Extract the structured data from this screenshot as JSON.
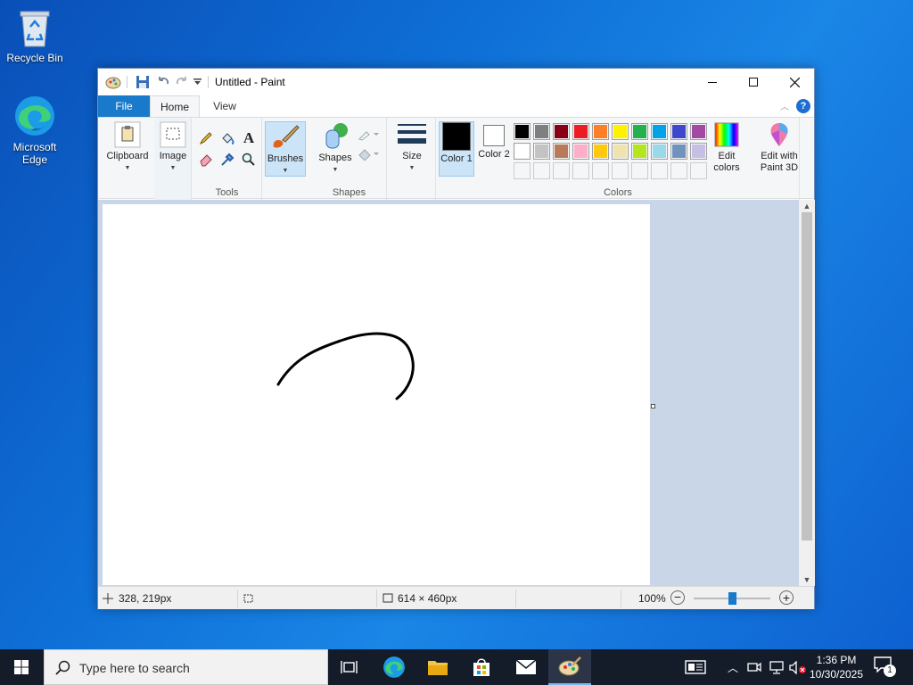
{
  "desktop": {
    "icons": [
      {
        "label": "Recycle Bin"
      },
      {
        "label": "Microsoft Edge"
      }
    ]
  },
  "window": {
    "title": "Untitled - Paint",
    "tabs": [
      "File",
      "Home",
      "View"
    ]
  },
  "ribbon": {
    "clipboard": "Clipboard",
    "image": "Image",
    "tools_label": "Tools",
    "brushes": "Brushes",
    "shapes": "Shapes",
    "shapes_label": "Shapes",
    "size": "Size",
    "color1": "Color 1",
    "color2": "Color 2",
    "colors_label": "Colors",
    "edit_colors": "Edit colors",
    "edit_paint3d": "Edit with Paint 3D",
    "color1_value": "#000000",
    "color2_value": "#ffffff",
    "palette_row1": [
      "#000000",
      "#7f7f7f",
      "#880015",
      "#ed1c24",
      "#ff7f27",
      "#fff200",
      "#22b14c",
      "#00a2e8",
      "#3f48cc",
      "#a349a4"
    ],
    "palette_row2": [
      "#ffffff",
      "#c3c3c3",
      "#b97a57",
      "#ffaec9",
      "#ffc90e",
      "#efe4b0",
      "#b5e61d",
      "#99d9ea",
      "#7092be",
      "#c8bfe7"
    ]
  },
  "status": {
    "cursor_pos": "328, 219px",
    "canvas_size": "614 × 460px",
    "zoom": "100%",
    "zoom_fraction": 0.5
  },
  "taskbar": {
    "search_placeholder": "Type here to search",
    "time": "1:36 PM",
    "date": "10/30/2025",
    "notifications": "1"
  }
}
